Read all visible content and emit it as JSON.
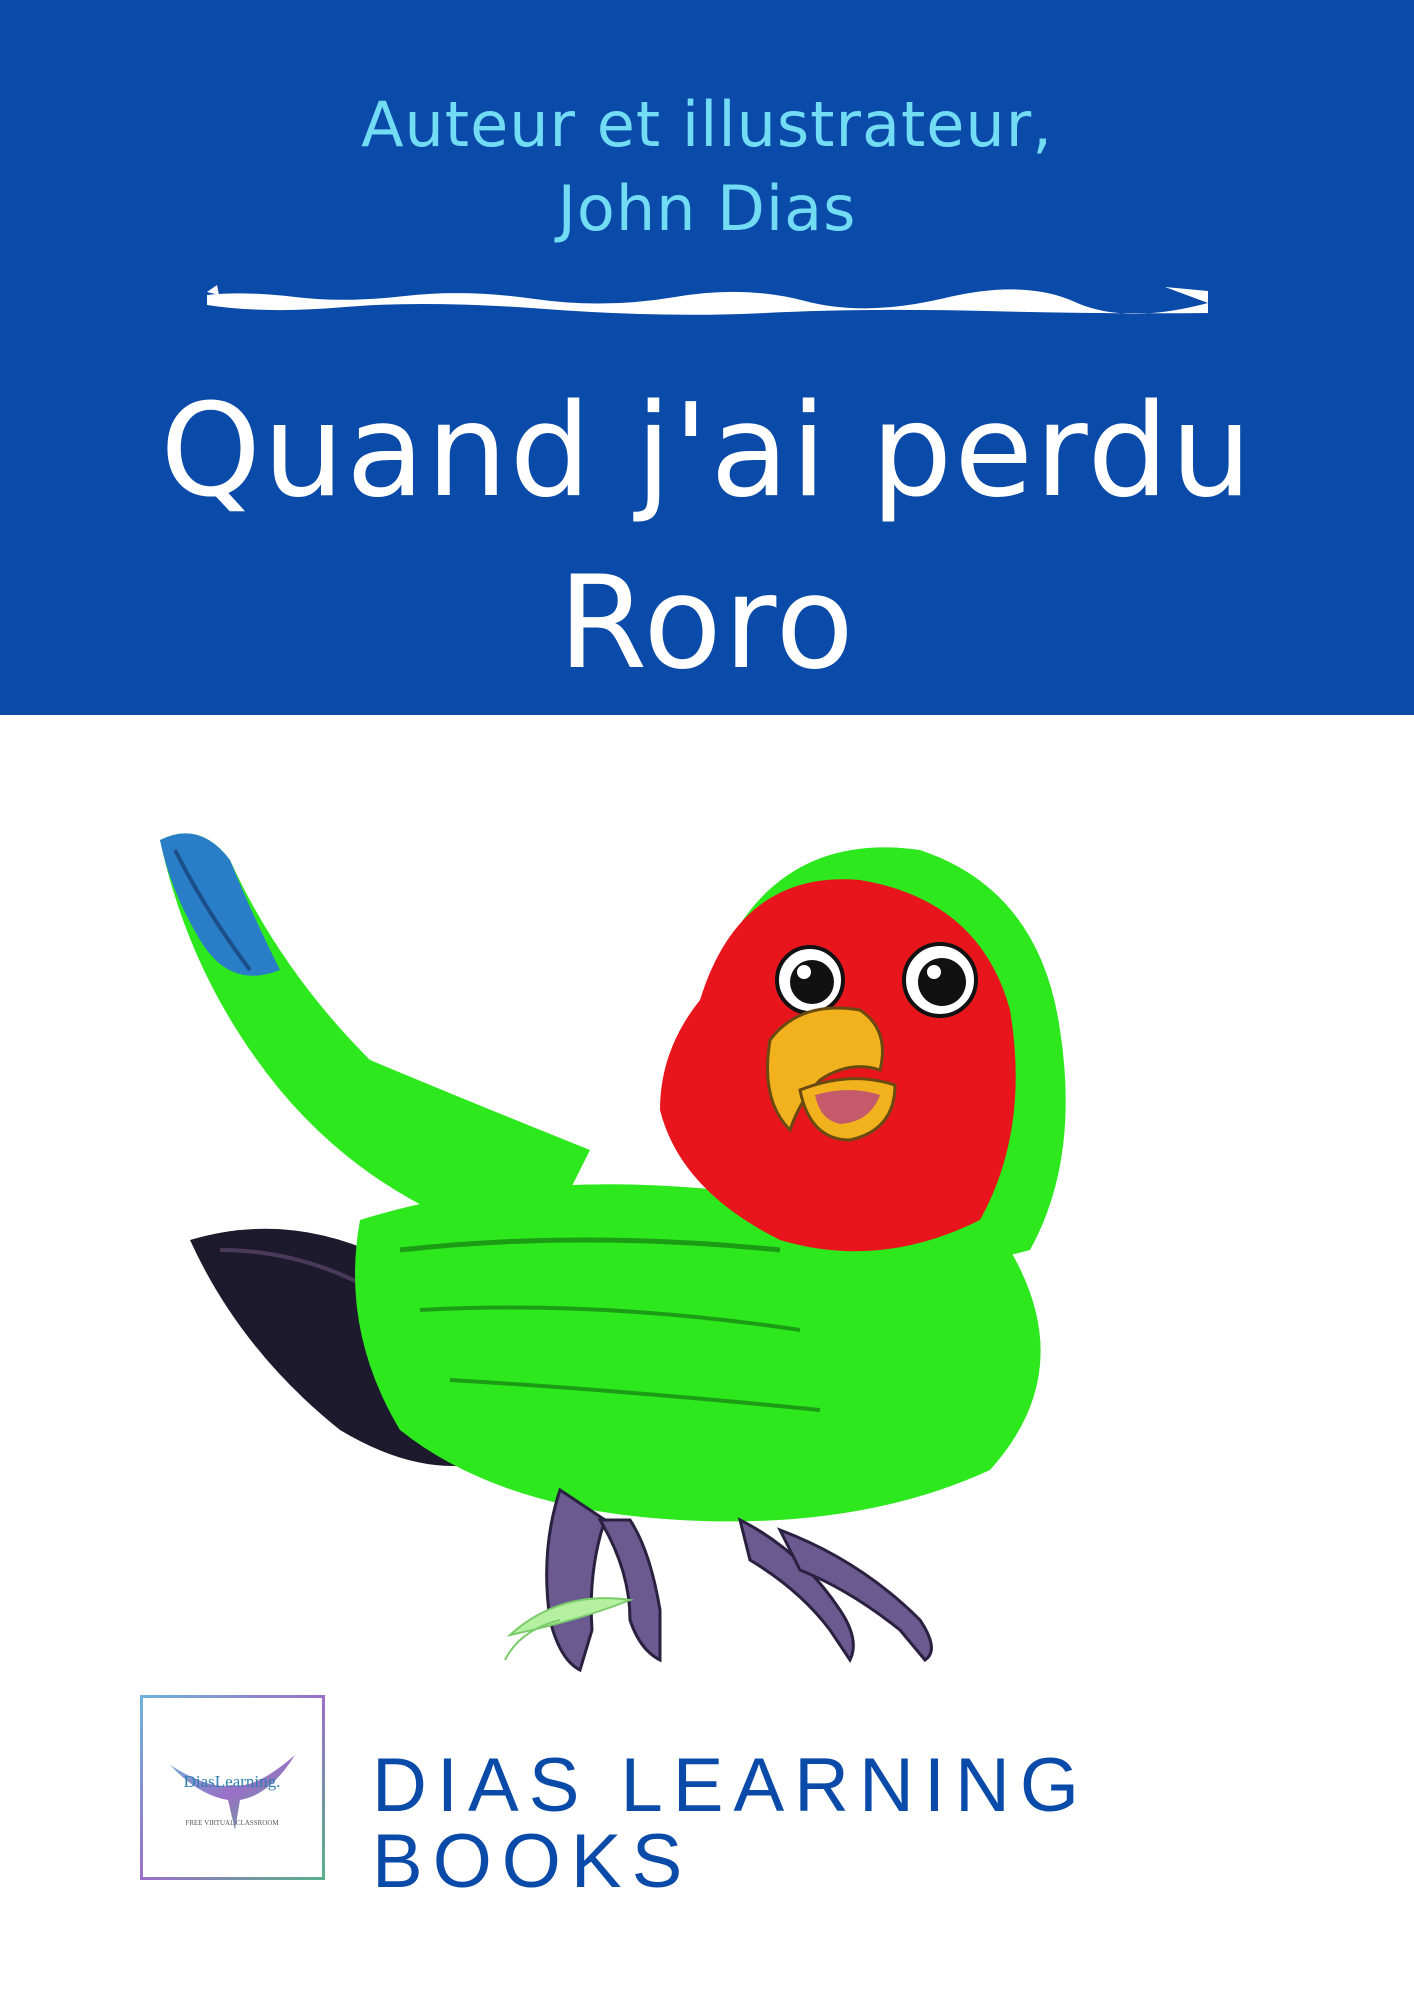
{
  "cover": {
    "author_line_1": "Auteur et illustrateur,",
    "author_line_2": "John Dias",
    "title_line_1": "Quand j'ai perdu",
    "title_line_2": "Roro",
    "publisher": "DIAS LEARNING BOOKS"
  },
  "logo": {
    "text": "DiasLearning.",
    "tagline": "FREE VIRTUAL CLASSROOM"
  },
  "colors": {
    "band": "#0a4aa8",
    "author_text": "#72dcf4",
    "title_text": "#ffffff",
    "publisher_text": "#0a4aa8",
    "parrot_green": "#2ee81e",
    "parrot_red": "#e8161c",
    "beak": "#f2b21e"
  },
  "illustration": {
    "subject": "parrot-icon"
  }
}
